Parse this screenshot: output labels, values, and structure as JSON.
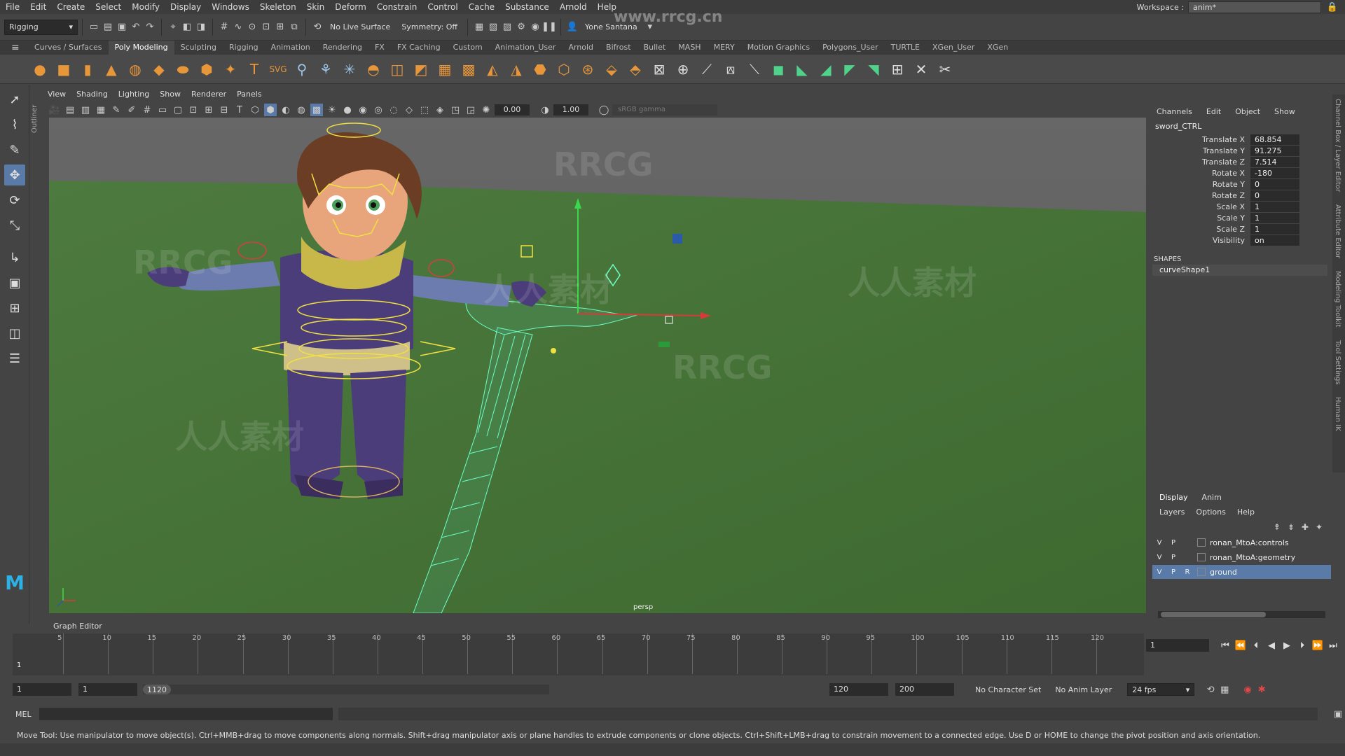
{
  "menubar": {
    "items": [
      "File",
      "Edit",
      "Create",
      "Select",
      "Modify",
      "Display",
      "Windows",
      "Skeleton",
      "Skin",
      "Deform",
      "Constrain",
      "Control",
      "Cache",
      "Substance",
      "Arnold",
      "Help"
    ],
    "workspace_label": "Workspace :",
    "workspace_value": "anim*"
  },
  "statusline": {
    "menuset": "Rigging",
    "live_surface": "No Live Surface",
    "symmetry": "Symmetry: Off",
    "user": "Yone Santana"
  },
  "shelf_tabs": {
    "tabs": [
      "Curves / Surfaces",
      "Poly Modeling",
      "Sculpting",
      "Rigging",
      "Animation",
      "Rendering",
      "FX",
      "FX Caching",
      "Custom",
      "Animation_User",
      "Arnold",
      "Bifrost",
      "Bullet",
      "MASH",
      "MERY",
      "Motion Graphics",
      "Polygons_User",
      "TURTLE",
      "XGen_User",
      "XGen"
    ],
    "active": "Poly Modeling"
  },
  "panel": {
    "menu": [
      "View",
      "Shading",
      "Lighting",
      "Show",
      "Renderer",
      "Panels"
    ],
    "exposure": "0.00",
    "gamma": "1.00",
    "colorspace": "sRGB gamma",
    "camera": "persp",
    "outliner_label": "Outliner"
  },
  "channel_box": {
    "menu": [
      "Channels",
      "Edit",
      "Object",
      "Show"
    ],
    "node": "sword_CTRL",
    "attributes": [
      {
        "name": "Translate X",
        "value": "68.854"
      },
      {
        "name": "Translate Y",
        "value": "91.275"
      },
      {
        "name": "Translate Z",
        "value": "7.514"
      },
      {
        "name": "Rotate X",
        "value": "-180"
      },
      {
        "name": "Rotate Y",
        "value": "0"
      },
      {
        "name": "Rotate Z",
        "value": "0"
      },
      {
        "name": "Scale X",
        "value": "1"
      },
      {
        "name": "Scale Y",
        "value": "1"
      },
      {
        "name": "Scale Z",
        "value": "1"
      },
      {
        "name": "Visibility",
        "value": "on"
      }
    ],
    "shapes_header": "SHAPES",
    "shape": "curveShape1"
  },
  "side_tabs": [
    "Channel Box / Layer Editor",
    "Attribute Editor",
    "Modeling Toolkit",
    "Tool Settings",
    "Human IK"
  ],
  "layer_editor": {
    "tabs": [
      "Display",
      "Anim"
    ],
    "menu": [
      "Layers",
      "Options",
      "Help"
    ],
    "layers": [
      {
        "v": "V",
        "p": "P",
        "r": "",
        "name": "ronan_MtoA:controls"
      },
      {
        "v": "V",
        "p": "P",
        "r": "",
        "name": "ronan_MtoA:geometry"
      },
      {
        "v": "V",
        "p": "P",
        "r": "R",
        "name": "ground"
      }
    ]
  },
  "graph_editor_label": "Graph Editor",
  "timeline": {
    "ticks": [
      "5",
      "10",
      "15",
      "20",
      "25",
      "30",
      "35",
      "40",
      "45",
      "50",
      "55",
      "60",
      "65",
      "70",
      "75",
      "80",
      "85",
      "90",
      "95",
      "100",
      "105",
      "110",
      "115",
      "120"
    ],
    "current_frame": "1",
    "playback_frame": "1"
  },
  "range": {
    "start": "1",
    "inner_start": "1",
    "slider_start": "1",
    "slider_end": "120",
    "inner_end": "120",
    "end": "200",
    "character_set": "No Character Set",
    "anim_layer": "No Anim Layer",
    "fps": "24 fps"
  },
  "command": {
    "label": "MEL"
  },
  "help_line": "Move Tool: Use manipulator to move object(s). Ctrl+MMB+drag to move components along normals. Shift+drag manipulator axis or plane handles to extrude components or clone objects. Ctrl+Shift+LMB+drag to constrain movement to a connected edge. Use D or HOME to change the pivot position and axis orientation.",
  "watermarks": {
    "top": "www.rrcg.cn",
    "latin": "RRCG",
    "cjk": "人人素材"
  },
  "colors": {
    "viewport_ground": "#3f5f34",
    "selection_blue": "#5a7ba8",
    "wire_green": "#4dffb0",
    "control_yellow": "#f0e040"
  }
}
